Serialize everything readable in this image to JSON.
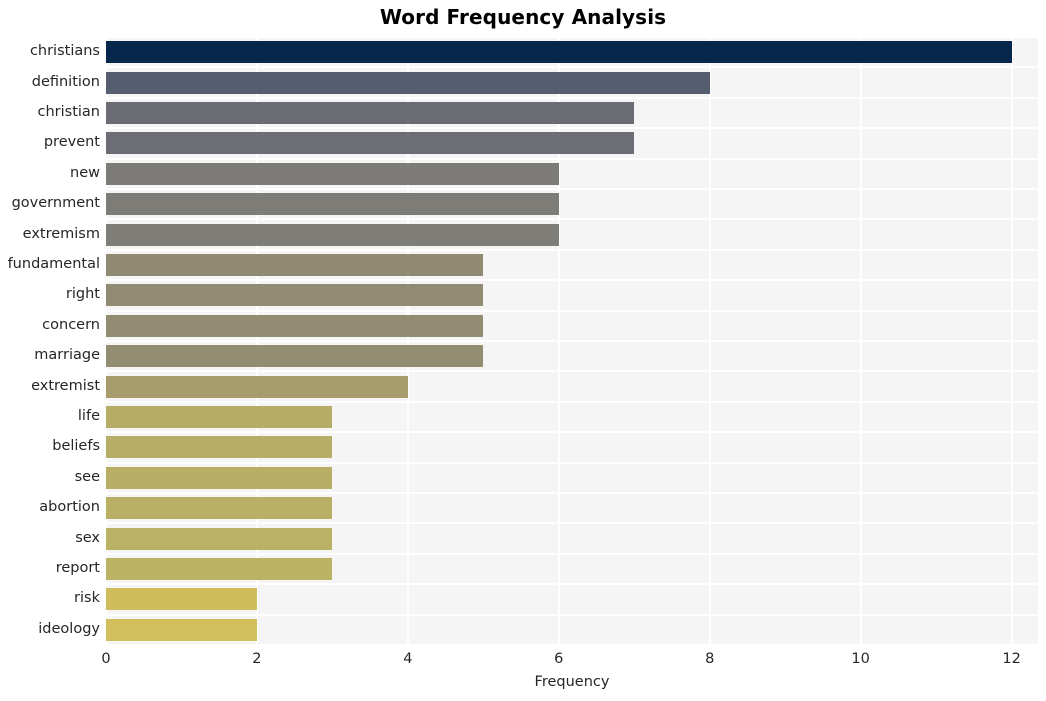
{
  "chart_data": {
    "type": "bar",
    "orientation": "horizontal",
    "title": "Word Frequency Analysis",
    "xlabel": "Frequency",
    "ylabel": "",
    "categories": [
      "christians",
      "definition",
      "christian",
      "prevent",
      "new",
      "government",
      "extremism",
      "fundamental",
      "right",
      "concern",
      "marriage",
      "extremist",
      "life",
      "beliefs",
      "see",
      "abortion",
      "sex",
      "report",
      "risk",
      "ideology"
    ],
    "values": [
      12,
      8,
      7,
      7,
      6,
      6,
      6,
      5,
      5,
      5,
      5,
      4,
      3,
      3,
      3,
      3,
      3,
      3,
      2,
      2
    ],
    "bar_colors": [
      "#06264c",
      "#575d71",
      "#6a6b73",
      "#6c6d75",
      "#7c7b77",
      "#7d7c77",
      "#7e7d77",
      "#908a73",
      "#918b73",
      "#928c72",
      "#938d72",
      "#a69c6c",
      "#b7ac66",
      "#b8ad66",
      "#b9ae65",
      "#bab065",
      "#bbb164",
      "#bcb263",
      "#cfbd5b",
      "#d0bf5a"
    ],
    "xlim": [
      0,
      12.35
    ],
    "xticks": [
      0,
      2,
      4,
      6,
      8,
      10,
      12
    ],
    "xtick_labels": [
      "0",
      "2",
      "4",
      "6",
      "8",
      "10",
      "12"
    ],
    "grid": true,
    "grid_color": "#ffffff",
    "legend": null,
    "plot_background": "#f5f5f5",
    "figure_background": "#ffffff",
    "text_color": "#262626"
  }
}
